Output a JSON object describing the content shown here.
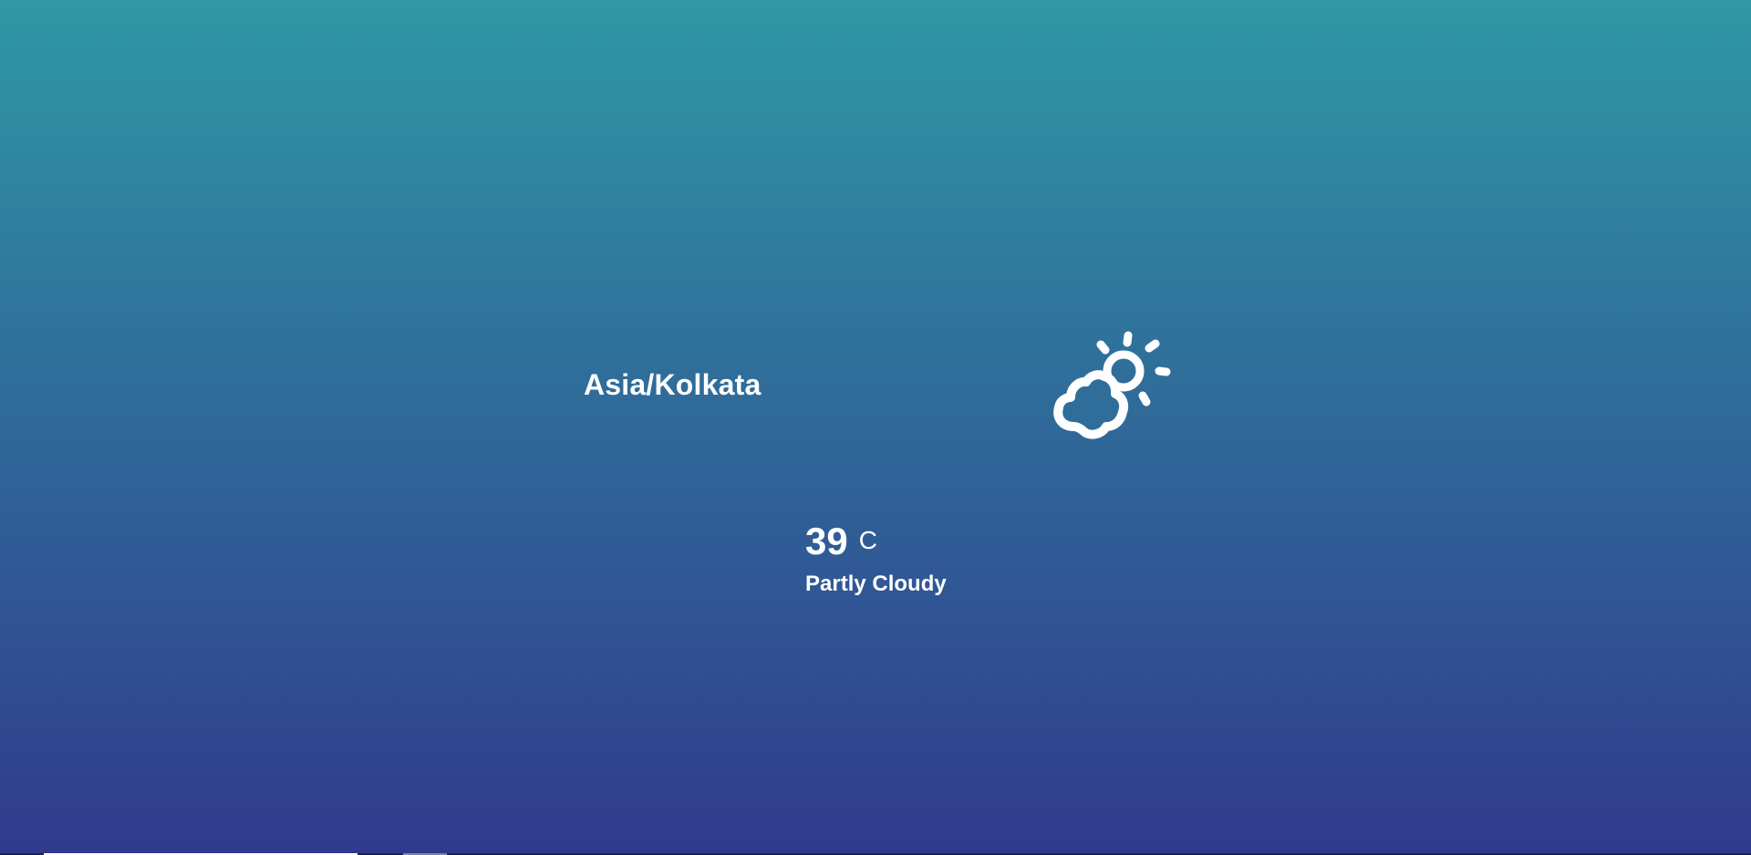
{
  "location": {
    "name": "Asia/Kolkata"
  },
  "weather": {
    "icon": "partly-cloudy-icon",
    "temperature": "39",
    "unit": "C",
    "condition": "Partly Cloudy"
  },
  "theme": {
    "gradient_top": "#2f98a6",
    "gradient_bottom": "#303a8d",
    "text_color": "#ffffff"
  }
}
